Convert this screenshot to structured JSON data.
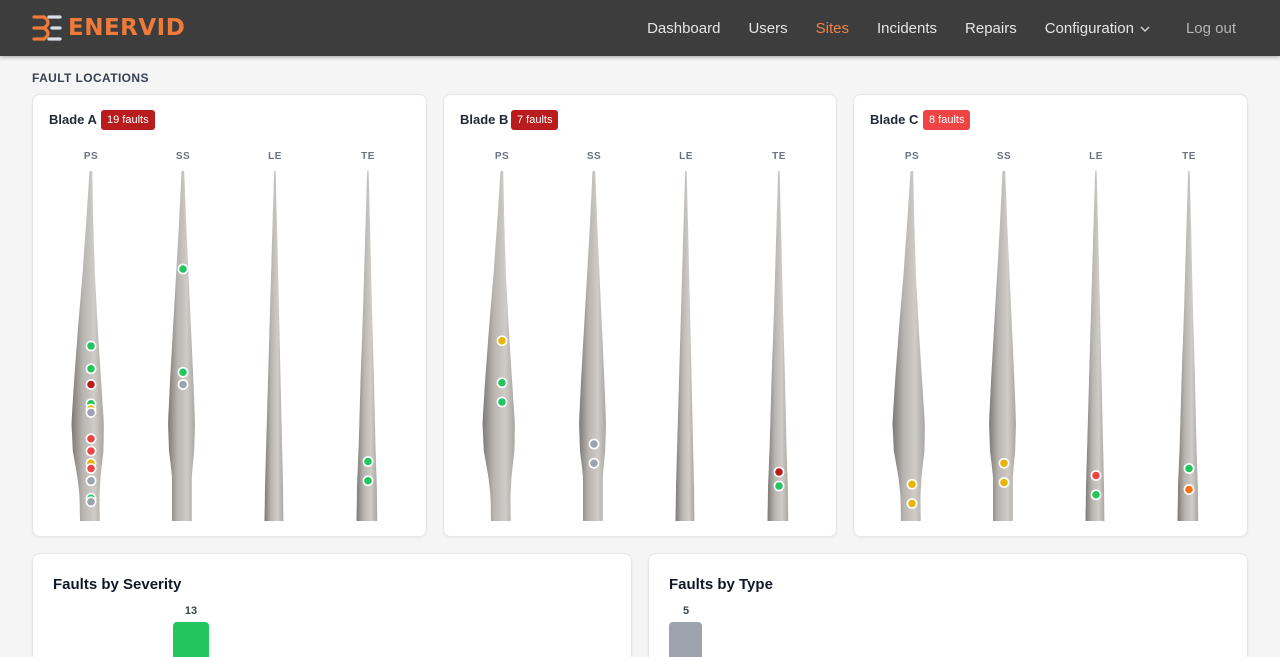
{
  "brand": {
    "name": "ENERVID",
    "accent": "#f07a3a"
  },
  "nav": {
    "dashboard": "Dashboard",
    "users": "Users",
    "sites": "Sites",
    "incidents": "Incidents",
    "repairs": "Repairs",
    "configuration": "Configuration",
    "logout": "Log out"
  },
  "section": {
    "title": "FAULT LOCATIONS"
  },
  "colors": {
    "green": "#22c55e",
    "red": "#ef4444",
    "darkred": "#b91c1c",
    "yellow": "#eab308",
    "orange": "#f97316",
    "gray": "#9ca3af",
    "badge_dark": "#b91c1c",
    "badge_light": "#ef4444"
  },
  "blades": [
    {
      "name": "Blade A",
      "badge": "19 faults",
      "badge_color": "#b91c1c",
      "sides": [
        {
          "label": "PS",
          "faults": [
            {
              "pos": 0.5,
              "color": "green"
            },
            {
              "pos": 0.565,
              "color": "green"
            },
            {
              "pos": 0.61,
              "color": "darkred"
            },
            {
              "pos": 0.665,
              "color": "green"
            },
            {
              "pos": 0.68,
              "color": "yellow"
            },
            {
              "pos": 0.69,
              "color": "gray"
            },
            {
              "pos": 0.765,
              "color": "red"
            },
            {
              "pos": 0.8,
              "color": "red"
            },
            {
              "pos": 0.835,
              "color": "yellow"
            },
            {
              "pos": 0.85,
              "color": "red"
            },
            {
              "pos": 0.885,
              "color": "gray"
            },
            {
              "pos": 0.935,
              "color": "green"
            },
            {
              "pos": 0.945,
              "color": "gray"
            }
          ]
        },
        {
          "label": "SS",
          "faults": [
            {
              "pos": 0.28,
              "color": "green"
            },
            {
              "pos": 0.575,
              "color": "green"
            },
            {
              "pos": 0.61,
              "color": "gray"
            }
          ]
        },
        {
          "label": "LE",
          "faults": []
        },
        {
          "label": "TE",
          "faults": [
            {
              "pos": 0.83,
              "color": "green"
            },
            {
              "pos": 0.885,
              "color": "green"
            }
          ]
        }
      ]
    },
    {
      "name": "Blade B",
      "badge": "7 faults",
      "badge_color": "#b91c1c",
      "sides": [
        {
          "label": "PS",
          "faults": [
            {
              "pos": 0.485,
              "color": "yellow"
            },
            {
              "pos": 0.605,
              "color": "green"
            },
            {
              "pos": 0.66,
              "color": "green"
            }
          ]
        },
        {
          "label": "SS",
          "faults": [
            {
              "pos": 0.78,
              "color": "gray"
            },
            {
              "pos": 0.835,
              "color": "gray"
            }
          ]
        },
        {
          "label": "LE",
          "faults": []
        },
        {
          "label": "TE",
          "faults": [
            {
              "pos": 0.86,
              "color": "darkred"
            },
            {
              "pos": 0.9,
              "color": "green"
            }
          ]
        }
      ]
    },
    {
      "name": "Blade C",
      "badge": "8 faults",
      "badge_color": "#ef4444",
      "sides": [
        {
          "label": "PS",
          "faults": [
            {
              "pos": 0.895,
              "color": "yellow"
            },
            {
              "pos": 0.95,
              "color": "yellow"
            }
          ]
        },
        {
          "label": "SS",
          "faults": [
            {
              "pos": 0.835,
              "color": "yellow"
            },
            {
              "pos": 0.89,
              "color": "yellow"
            }
          ]
        },
        {
          "label": "LE",
          "faults": [
            {
              "pos": 0.87,
              "color": "red"
            },
            {
              "pos": 0.925,
              "color": "green"
            }
          ]
        },
        {
          "label": "TE",
          "faults": [
            {
              "pos": 0.85,
              "color": "green"
            },
            {
              "pos": 0.91,
              "color": "orange"
            }
          ]
        }
      ]
    }
  ],
  "chart_data": [
    {
      "type": "bar",
      "title": "Faults by Severity",
      "value_labels": [
        "13"
      ],
      "values": [
        13
      ],
      "colors": [
        "#22c55e"
      ]
    },
    {
      "type": "bar",
      "title": "Faults by Type",
      "value_labels": [
        "5"
      ],
      "values": [
        5
      ],
      "colors": [
        "#9ca3af"
      ]
    }
  ]
}
